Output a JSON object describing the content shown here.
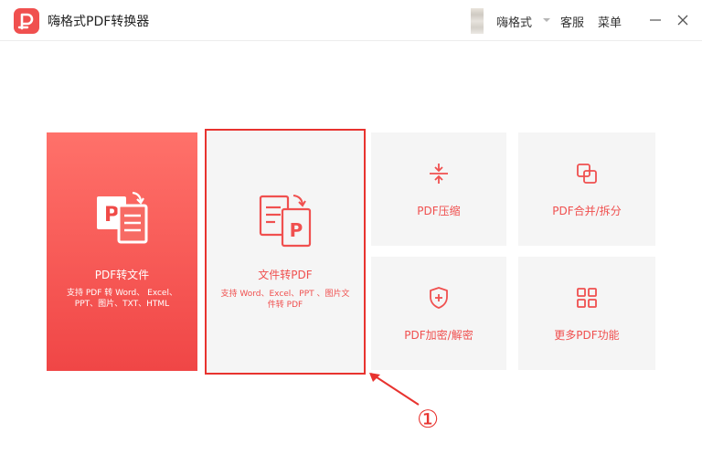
{
  "app": {
    "title": "嗨格式PDF转换器"
  },
  "header": {
    "username": "嗨格式",
    "service_label": "客服",
    "menu_label": "菜单"
  },
  "cards": {
    "pdf_to_file": {
      "title": "PDF转文件",
      "desc_line1": "支持 PDF 转 Word、 Excel、",
      "desc_line2": "PPT、图片、TXT、HTML"
    },
    "file_to_pdf": {
      "title": "文件转PDF",
      "desc_line1": "支持 Word、Excel、PPT 、图片文",
      "desc_line2": "件转 PDF"
    },
    "compress": {
      "title": "PDF压缩"
    },
    "merge_split": {
      "title": "PDF合并/拆分"
    },
    "encrypt": {
      "title": "PDF加密/解密"
    },
    "more": {
      "title": "更多PDF功能"
    }
  },
  "annotation": {
    "marker": "①"
  },
  "colors": {
    "accent": "#f0504f",
    "highlight": "#e8332f",
    "card_bg": "#f5f5f5"
  },
  "icons": [
    "app-logo",
    "avatar",
    "dropdown-icon",
    "minimize-icon",
    "close-icon",
    "pdf-to-file-icon",
    "file-to-pdf-icon",
    "compress-icon",
    "merge-icon",
    "shield-icon",
    "grid-icon"
  ]
}
